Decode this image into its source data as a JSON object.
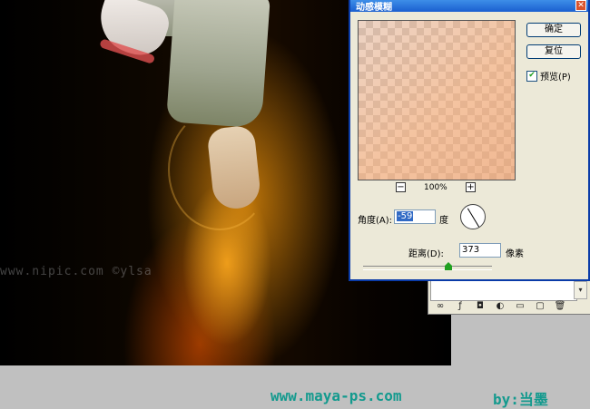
{
  "dialog": {
    "title": "动感模糊",
    "close_glyph": "✕",
    "ok_label": "确定",
    "reset_label": "复位",
    "preview_label": "预览(P)",
    "preview_checked": true,
    "zoom": {
      "minus": "−",
      "plus": "+",
      "value": "100%"
    },
    "angle": {
      "label": "角度(A):",
      "value": "-59",
      "unit": "度"
    },
    "distance": {
      "label": "距离(D):",
      "value": "373",
      "unit": "像素"
    }
  },
  "layers_panel": {
    "scroll_glyph": "▾",
    "tools": [
      "∞",
      "ƒ",
      "◘",
      "◐",
      "▭",
      "▢",
      "🗑"
    ]
  },
  "canvas": {
    "watermark": "www.nipic.com   ©ylsa"
  },
  "credit": {
    "site": "www.maya-ps.com",
    "author": "by:当墨"
  },
  "colors": {
    "title_bar": "#1a5fd0",
    "dialog_bg": "#ece9d8",
    "credit_text": "#149a8e"
  }
}
